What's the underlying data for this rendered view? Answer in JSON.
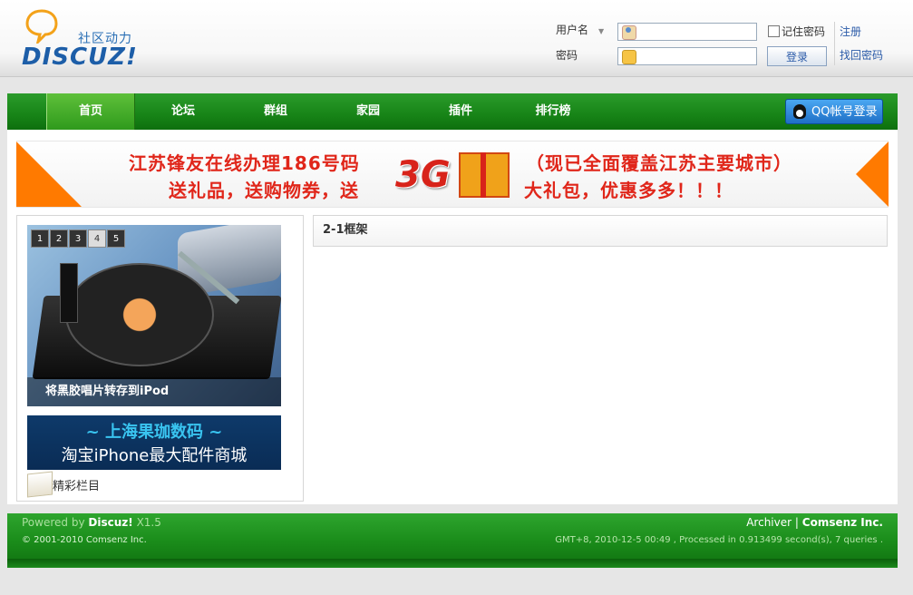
{
  "header": {
    "logo_sub": "社区动力",
    "logo_main": "DISCUZ!",
    "username_label": "用户名",
    "password_label": "密码",
    "username_value": "",
    "password_value": "",
    "remember_label": "记住密码",
    "register_link": "注册",
    "login_button": "登录",
    "forgot_link": "找回密码"
  },
  "nav": {
    "items": [
      "首页",
      "论坛",
      "群组",
      "家园",
      "插件",
      "排行榜"
    ],
    "active_index": 0,
    "qq_login": "QQ帐号登录"
  },
  "banner": {
    "line1": "江苏锋友在线办理186号码",
    "line2": "送礼品，送购物券，送",
    "line3": "（现已全面覆盖江苏主要城市）",
    "line4": "大礼包，优惠多多！！！",
    "badge": "3G"
  },
  "slideshow": {
    "pages": [
      "1",
      "2",
      "3",
      "4",
      "5"
    ],
    "active_page": 3,
    "caption": "将黑胶唱片转存到iPod"
  },
  "promo": {
    "line1": "~ 上海果珈数码 ~",
    "line2": "淘宝iPhone最大配件商城"
  },
  "section": {
    "title": "精彩栏目"
  },
  "right_frame": {
    "title": "2-1框架"
  },
  "footer": {
    "powered_prefix": "Powered by",
    "powered_brand": "Discuz!",
    "powered_version": "X1.5",
    "copyright": "© 2001-2010 Comsenz Inc.",
    "archiver": "Archiver",
    "separator": "|",
    "company": "Comsenz Inc.",
    "stats": "GMT+8, 2010-12-5 00:49 , Processed in 0.913499 second(s), 7 queries ."
  },
  "colors": {
    "nav_green": "#178417",
    "banner_red": "#e0261a",
    "link_blue": "#2a5aa8",
    "accent_orange": "#ff7a00"
  }
}
